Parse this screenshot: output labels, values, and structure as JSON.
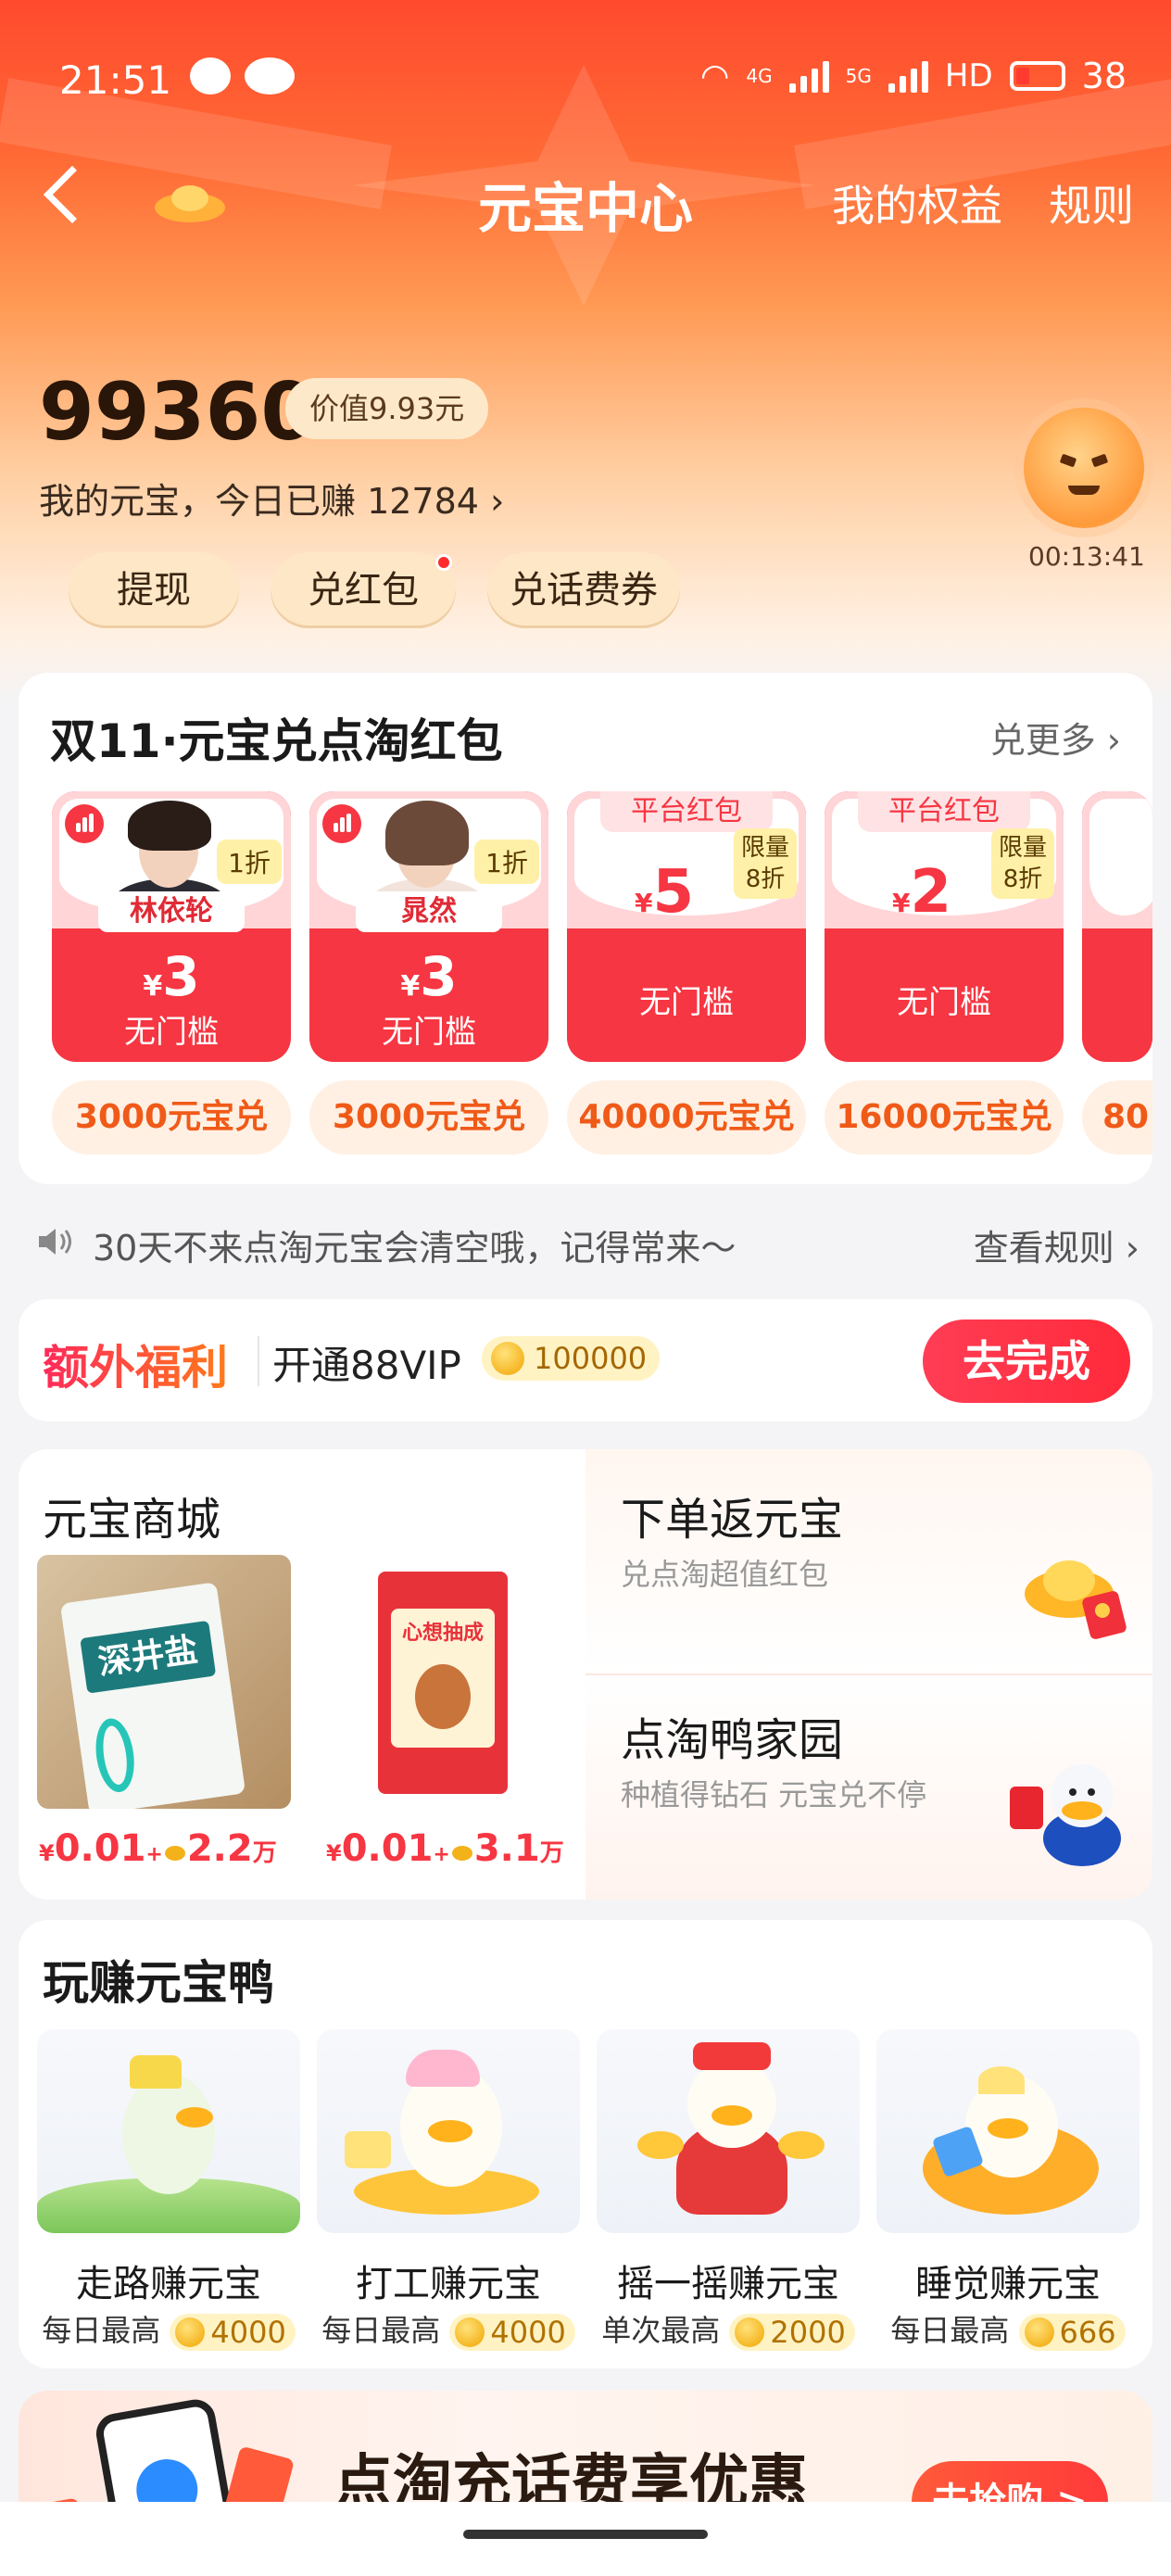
{
  "status_bar": {
    "time": "21:51",
    "net1": "4G",
    "net2": "5G",
    "hd": "HD",
    "battery": "38"
  },
  "nav": {
    "title": "元宝中心",
    "my_benefits": "我的权益",
    "rules": "规则"
  },
  "balance": {
    "amount": "99360",
    "value_pill": "价值9.93元",
    "subtitle": "我的元宝，今日已赚 12784",
    "timer": "00:13:41"
  },
  "actions": [
    "提现",
    "兑红包",
    "兑话费券"
  ],
  "redeem": {
    "title": "双11·元宝兑点淘红包",
    "more": "兑更多",
    "coupons": [
      {
        "name": "林依轮",
        "discount": "1折",
        "currency": "¥",
        "amount": "3",
        "condition": "无门槛",
        "cost": "3000元宝兑"
      },
      {
        "name": "晁然",
        "discount": "1折",
        "currency": "¥",
        "amount": "3",
        "condition": "无门槛",
        "cost": "3000元宝兑"
      },
      {
        "tag": "平台红包",
        "discount_line1": "限量",
        "discount_line2": "8折",
        "currency": "¥",
        "amount": "5",
        "condition": "无门槛",
        "cost": "40000元宝兑"
      },
      {
        "tag": "平台红包",
        "discount_line1": "限量",
        "discount_line2": "8折",
        "currency": "¥",
        "amount": "2",
        "condition": "无门槛",
        "cost": "16000元宝兑"
      }
    ],
    "partial_cost": "80"
  },
  "notice": {
    "text": "30天不来点淘元宝会清空哦，记得常来～",
    "link": "查看规则"
  },
  "extra": {
    "title": "额外福利",
    "text": "开通88VIP",
    "coins": "100000",
    "button": "去完成"
  },
  "mall": {
    "title": "元宝商城",
    "products": [
      {
        "label": "深井盐",
        "currency": "¥",
        "price": "0.01",
        "plus": "+",
        "coins": "2.2",
        "unit": "万"
      },
      {
        "label": "心想抽成",
        "currency": "¥",
        "price": "0.01",
        "plus": "+",
        "coins": "3.1",
        "unit": "万"
      }
    ],
    "right": [
      {
        "title": "下单返元宝",
        "subtitle": "兑点淘超值红包"
      },
      {
        "title": "点淘鸭家园",
        "subtitle": "种植得钻石 元宝兑不停"
      }
    ]
  },
  "play": {
    "title": "玩赚元宝鸭",
    "items": [
      {
        "name": "走路赚元宝",
        "prefix": "每日最高",
        "coins": "4000"
      },
      {
        "name": "打工赚元宝",
        "prefix": "每日最高",
        "coins": "4000"
      },
      {
        "name": "摇一摇赚元宝",
        "prefix": "单次最高",
        "coins": "2000"
      },
      {
        "name": "睡觉赚元宝",
        "prefix": "每日最高",
        "coins": "666"
      }
    ]
  },
  "banner": {
    "text": "点淘充话费享优惠",
    "button": "去抢购 >"
  },
  "colors": {
    "brand_red": "#f63642",
    "accent_orange": "#f05a18",
    "coin_gold": "#f1a400"
  }
}
